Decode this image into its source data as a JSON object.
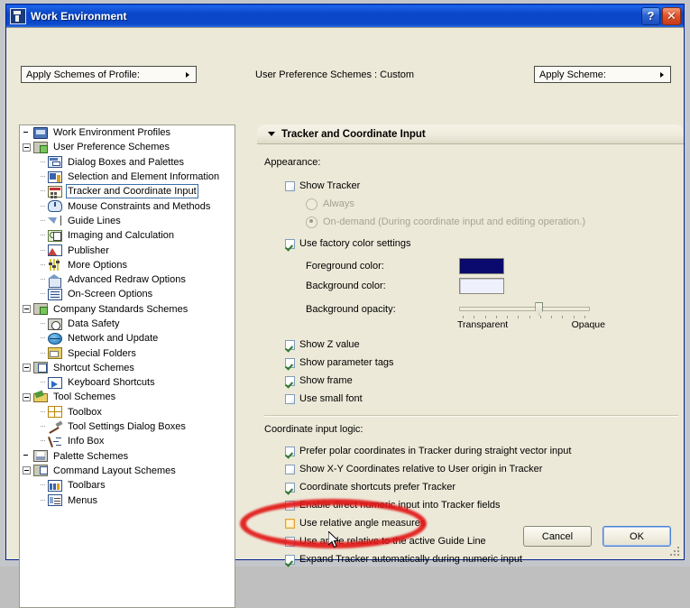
{
  "window": {
    "title": "Work Environment",
    "help_label": "?",
    "close_label": "✕"
  },
  "toolbar": {
    "profile_combo": "Apply Schemes of Profile:",
    "scheme_status": "User Preference Schemes : Custom",
    "scheme_combo": "Apply Scheme:"
  },
  "tree": {
    "nodes": [
      {
        "label": "Work Environment Profiles",
        "depth": 0,
        "expander": "none",
        "icon": "monitor-icon",
        "selected": false
      },
      {
        "label": "User Preference Schemes",
        "depth": 0,
        "expander": "minus",
        "icon": "folder-green-icon",
        "selected": false
      },
      {
        "label": "Dialog Boxes and Palettes",
        "depth": 1,
        "expander": "dots",
        "icon": "dialogs-icon",
        "selected": false
      },
      {
        "label": "Selection and Element Information",
        "depth": 1,
        "expander": "dots",
        "icon": "selection-icon",
        "selected": false
      },
      {
        "label": "Tracker and Coordinate Input",
        "depth": 1,
        "expander": "dots",
        "icon": "tracker-icon",
        "selected": true
      },
      {
        "label": "Mouse Constraints and Methods",
        "depth": 1,
        "expander": "dots",
        "icon": "mouse-icon",
        "selected": false
      },
      {
        "label": "Guide Lines",
        "depth": 1,
        "expander": "dots",
        "icon": "guide-icon",
        "selected": false
      },
      {
        "label": "Imaging and Calculation",
        "depth": 1,
        "expander": "dots",
        "icon": "imaging-icon",
        "selected": false
      },
      {
        "label": "Publisher",
        "depth": 1,
        "expander": "dots",
        "icon": "publisher-icon",
        "selected": false
      },
      {
        "label": "More Options",
        "depth": 1,
        "expander": "dots",
        "icon": "more-options-icon",
        "selected": false
      },
      {
        "label": "Advanced Redraw Options",
        "depth": 1,
        "expander": "dots",
        "icon": "redraw-icon",
        "selected": false
      },
      {
        "label": "On-Screen Options",
        "depth": 1,
        "expander": "dots",
        "icon": "on-screen-icon",
        "selected": false
      },
      {
        "label": "Company Standards Schemes",
        "depth": 0,
        "expander": "minus",
        "icon": "folder-company-icon",
        "selected": false
      },
      {
        "label": "Data Safety",
        "depth": 1,
        "expander": "dots",
        "icon": "data-safety-icon",
        "selected": false
      },
      {
        "label": "Network and Update",
        "depth": 1,
        "expander": "dots",
        "icon": "network-icon",
        "selected": false
      },
      {
        "label": "Special Folders",
        "depth": 1,
        "expander": "dots",
        "icon": "special-folders-icon",
        "selected": false
      },
      {
        "label": "Shortcut Schemes",
        "depth": 0,
        "expander": "minus",
        "icon": "shortcut-icon",
        "selected": false
      },
      {
        "label": "Keyboard Shortcuts",
        "depth": 1,
        "expander": "dots",
        "icon": "keyboard-icon",
        "selected": false
      },
      {
        "label": "Tool Schemes",
        "depth": 0,
        "expander": "minus",
        "icon": "tool-schemes-icon",
        "selected": false
      },
      {
        "label": "Toolbox",
        "depth": 1,
        "expander": "dots",
        "icon": "toolbox-icon",
        "selected": false
      },
      {
        "label": "Tool Settings Dialog Boxes",
        "depth": 1,
        "expander": "dots",
        "icon": "hammer-icon",
        "selected": false
      },
      {
        "label": "Info Box",
        "depth": 1,
        "expander": "dots",
        "icon": "info-box-icon",
        "selected": false
      },
      {
        "label": "Palette Schemes",
        "depth": 0,
        "expander": "none",
        "icon": "palette-icon",
        "selected": false
      },
      {
        "label": "Command Layout Schemes",
        "depth": 0,
        "expander": "minus",
        "icon": "command-layout-icon",
        "selected": false
      },
      {
        "label": "Toolbars",
        "depth": 1,
        "expander": "dots",
        "icon": "toolbars-icon",
        "selected": false
      },
      {
        "label": "Menus",
        "depth": 1,
        "expander": "dots",
        "icon": "menus-icon",
        "selected": false
      }
    ]
  },
  "pane": {
    "header": "Tracker and Coordinate Input",
    "appearance_label": "Appearance:",
    "show_tracker": {
      "label": "Show Tracker",
      "checked": false
    },
    "radios": [
      {
        "label": "Always",
        "selected": false,
        "disabled": true
      },
      {
        "label": "On-demand (During coordinate input and editing operation.)",
        "selected": true,
        "disabled": true
      }
    ],
    "use_factory": {
      "label": "Use factory color settings",
      "checked": true
    },
    "colors": [
      {
        "caption": "Foreground color:",
        "value": "#0a0a6e"
      },
      {
        "caption": "Background color:",
        "value": "#eef0fb"
      }
    ],
    "opacity": {
      "caption": "Background opacity:",
      "min_label": "Transparent",
      "max_label": "Opaque",
      "value_percent": 62,
      "tick_count": 12
    },
    "appearance_checks": [
      {
        "label": "Show Z value",
        "checked": true
      },
      {
        "label": "Show parameter tags",
        "checked": true
      },
      {
        "label": "Show frame",
        "checked": true
      },
      {
        "label": "Use small font",
        "checked": false
      }
    ],
    "logic_label": "Coordinate input logic:",
    "logic_checks": [
      {
        "label": "Prefer polar coordinates in Tracker during straight vector input",
        "checked": true,
        "highlight": false
      },
      {
        "label": "Show X-Y Coordinates relative to User origin in Tracker",
        "checked": false,
        "highlight": false
      },
      {
        "label": "Coordinate shortcuts prefer Tracker",
        "checked": true,
        "highlight": false
      },
      {
        "label": "Enable direct numeric input into Tracker fields",
        "checked": false,
        "highlight": false
      },
      {
        "label": "Use relative angle measures",
        "checked": false,
        "highlight": true
      },
      {
        "label": "Use angle relative to the active Guide Line",
        "checked": false,
        "highlight": false
      },
      {
        "label": "Expand Tracker automatically during numeric input",
        "checked": true,
        "highlight": false
      }
    ]
  },
  "footer": {
    "cancel_label": "Cancel",
    "ok_label": "OK"
  },
  "annotation": {
    "color": "#e21414",
    "shape": "ellipse",
    "targets": "Use relative angle measures"
  }
}
